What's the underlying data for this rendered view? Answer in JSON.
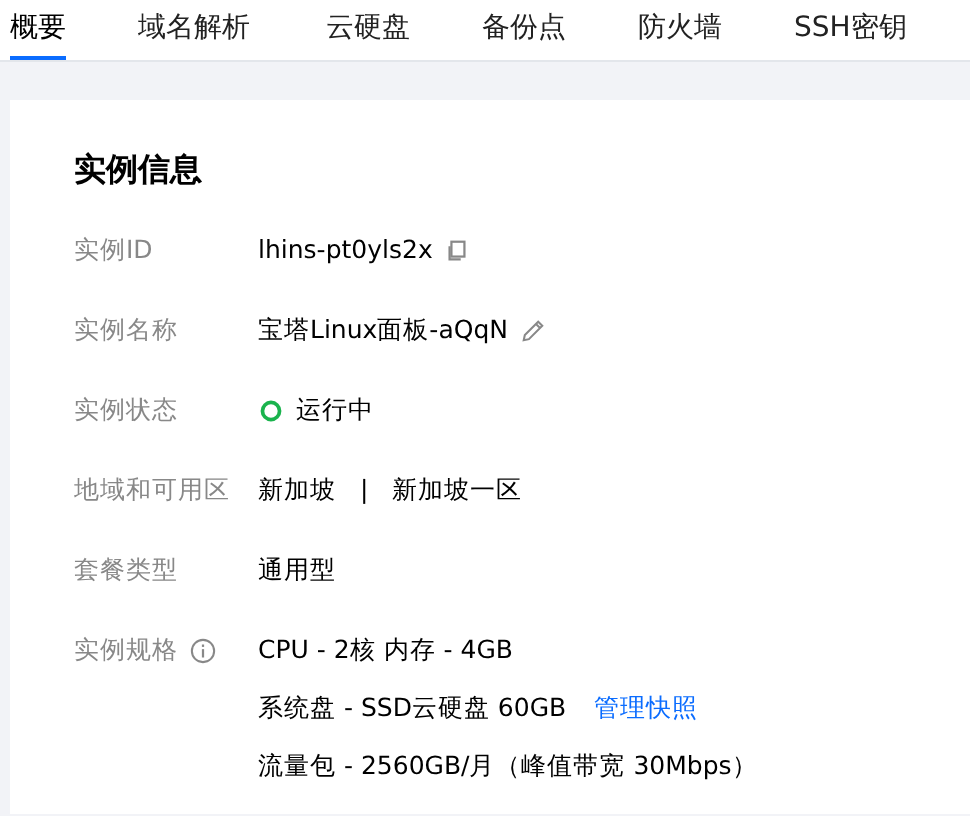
{
  "tabs": [
    {
      "label": "概要",
      "selected": true
    },
    {
      "label": "域名解析",
      "selected": false
    },
    {
      "label": "云硬盘",
      "selected": false
    },
    {
      "label": "备份点",
      "selected": false
    },
    {
      "label": "防火墙",
      "selected": false
    },
    {
      "label": "SSH密钥",
      "selected": false
    }
  ],
  "card": {
    "title": "实例信息",
    "rows": [
      {
        "label": "实例ID",
        "kind": "copy",
        "values": [
          "lhins-pt0yls2x"
        ]
      },
      {
        "label": "实例名称",
        "kind": "edit",
        "values": [
          "宝塔Linux面板-aQqN"
        ]
      },
      {
        "label": "实例状态",
        "kind": "status",
        "color": "#1ab34d",
        "values": [
          "运行中"
        ]
      },
      {
        "label": "地域和可用区",
        "kind": "region",
        "values": [
          "新加坡",
          "|",
          "新加坡一区"
        ]
      },
      {
        "label": "套餐类型",
        "kind": "text",
        "values": [
          "通用型"
        ]
      },
      {
        "label": "实例规格",
        "kind": "spec",
        "lines": [
          {
            "text": "CPU - 2核 内存 - 4GB"
          },
          {
            "text": "系统盘 - SSD云硬盘 60GB",
            "link": "管理快照"
          },
          {
            "text": "流量包 - 2560GB/月（峰值带宽 30Mbps）"
          }
        ]
      }
    ]
  }
}
